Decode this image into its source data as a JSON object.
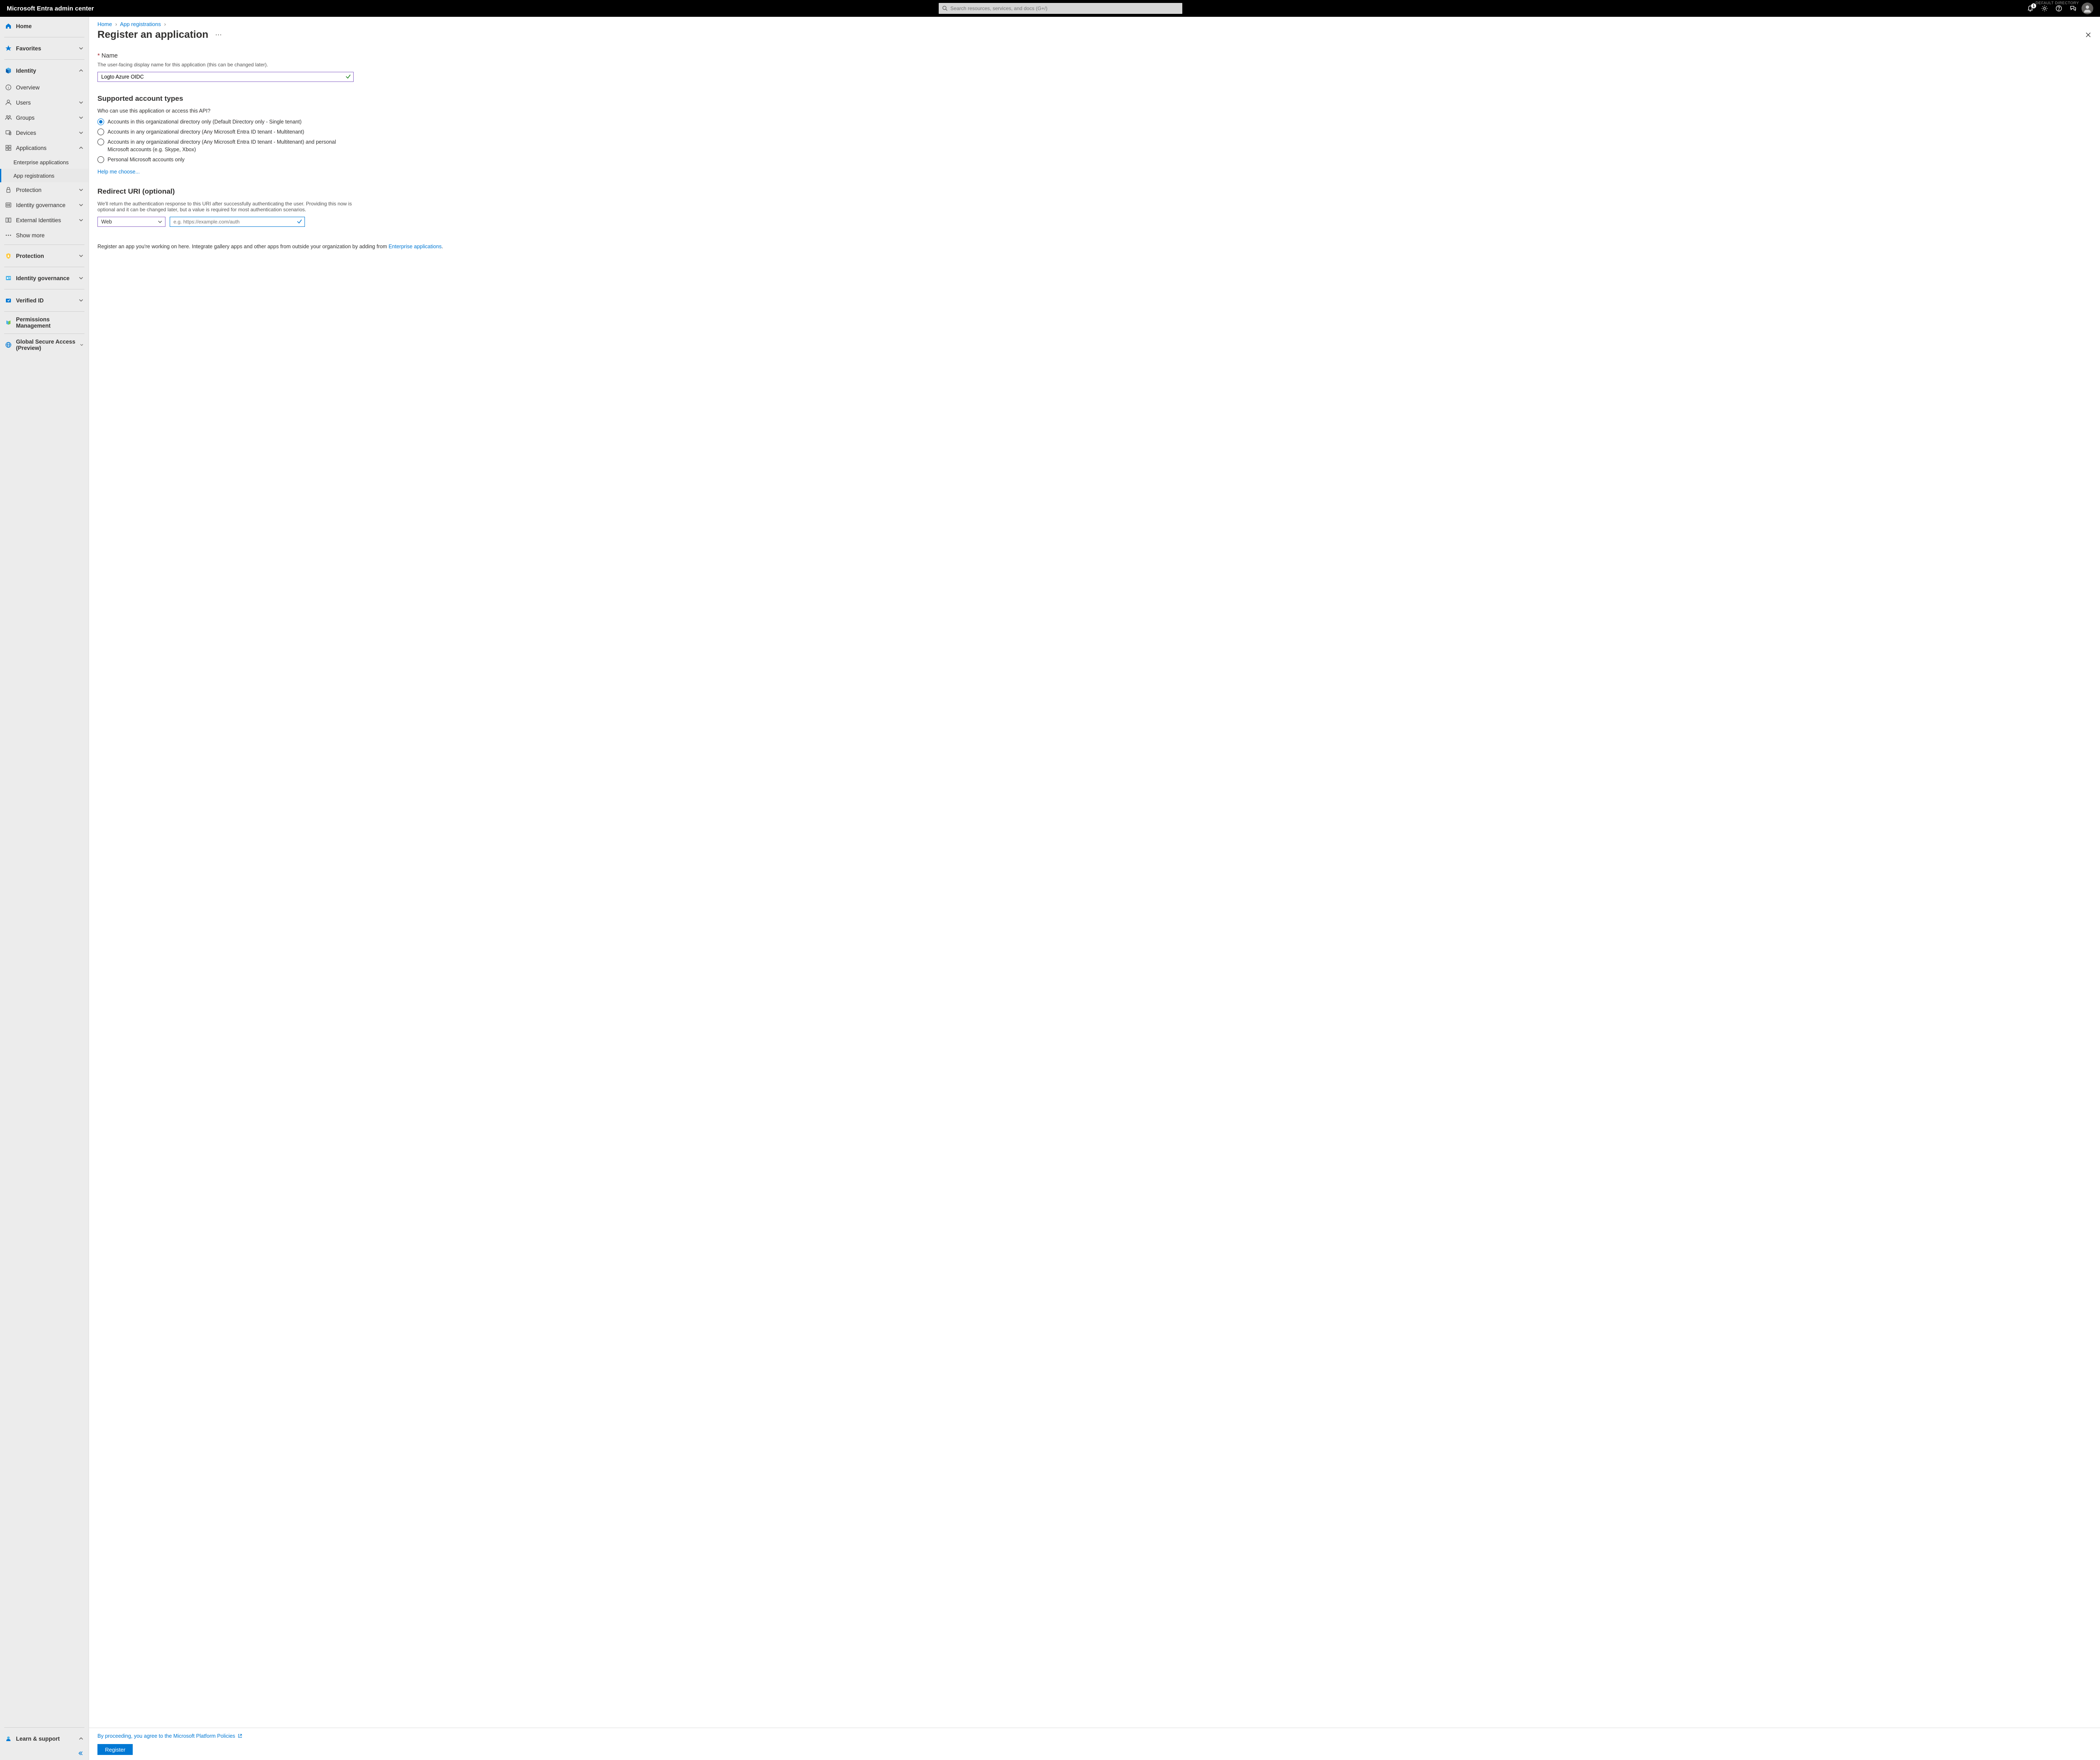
{
  "header": {
    "brand": "Microsoft Entra admin center",
    "search_placeholder": "Search resources, services, and docs (G+/)",
    "directory_label": "DEFAULT DIRECTORY",
    "notification_count": "1"
  },
  "sidebar": {
    "home": "Home",
    "favorites": "Favorites",
    "identity": "Identity",
    "identity_items": {
      "overview": "Overview",
      "users": "Users",
      "groups": "Groups",
      "devices": "Devices",
      "applications": "Applications",
      "enterprise_apps": "Enterprise applications",
      "app_registrations": "App registrations",
      "protection": "Protection",
      "identity_governance": "Identity governance",
      "external_identities": "External Identities",
      "show_more": "Show more"
    },
    "protection_top": "Protection",
    "id_gov_top": "Identity governance",
    "verified_id": "Verified ID",
    "permissions_mgmt": "Permissions Management",
    "global_secure": "Global Secure Access (Preview)",
    "learn_support": "Learn & support"
  },
  "breadcrumb": {
    "home": "Home",
    "app_reg": "App registrations"
  },
  "page": {
    "title": "Register an application"
  },
  "name_section": {
    "label": "Name",
    "hint": "The user-facing display name for this application (this can be changed later).",
    "value": "Logto Azure OIDC"
  },
  "account_types": {
    "title": "Supported account types",
    "question": "Who can use this application or access this API?",
    "options": [
      "Accounts in this organizational directory only (Default Directory only - Single tenant)",
      "Accounts in any organizational directory (Any Microsoft Entra ID tenant - Multitenant)",
      "Accounts in any organizational directory (Any Microsoft Entra ID tenant - Multitenant) and personal Microsoft accounts (e.g. Skype, Xbox)",
      "Personal Microsoft accounts only"
    ],
    "help_link": "Help me choose..."
  },
  "redirect": {
    "title": "Redirect URI (optional)",
    "hint": "We'll return the authentication response to this URI after successfully authenticating the user. Providing this now is optional and it can be changed later, but a value is required for most authentication scenarios.",
    "platform": "Web",
    "uri_placeholder": "e.g. https://example.com/auth"
  },
  "footer": {
    "note_prefix": "Register an app you're working on here. Integrate gallery apps and other apps from outside your organization by adding from ",
    "note_link": "Enterprise applications",
    "agree_text": "By proceeding, you agree to the Microsoft Platform Policies",
    "register_btn": "Register"
  }
}
